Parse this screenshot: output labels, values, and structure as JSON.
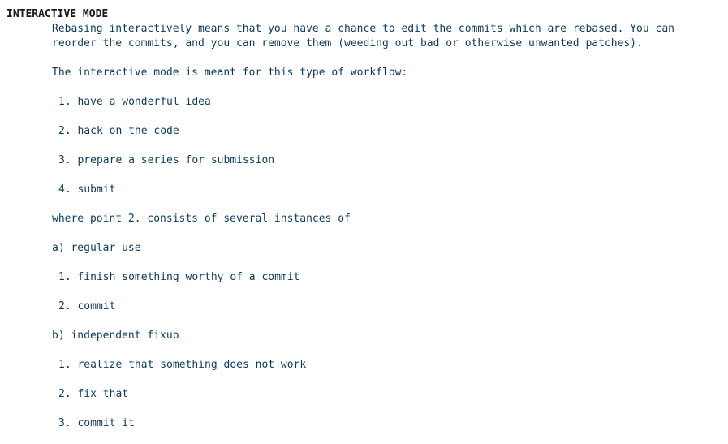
{
  "section": {
    "heading": "INTERACTIVE MODE",
    "intro_line1": "Rebasing interactively means that you have a chance to edit the commits which are rebased. You can",
    "intro_line2": "reorder the commits, and you can remove them (weeding out bad or otherwise unwanted patches).",
    "workflow_intro": "The interactive mode is meant for this type of workflow:",
    "workflow_steps": [
      "1. have a wonderful idea",
      "2. hack on the code",
      "3. prepare a series for submission",
      "4. submit"
    ],
    "where_text": "where point 2. consists of several instances of",
    "regular_use": {
      "label": "a) regular use",
      "steps": [
        "1. finish something worthy of a commit",
        "2. commit"
      ]
    },
    "independent_fixup": {
      "label": "b) independent fixup",
      "steps": [
        "1. realize that something does not work",
        "2. fix that",
        "3. commit it"
      ]
    }
  }
}
